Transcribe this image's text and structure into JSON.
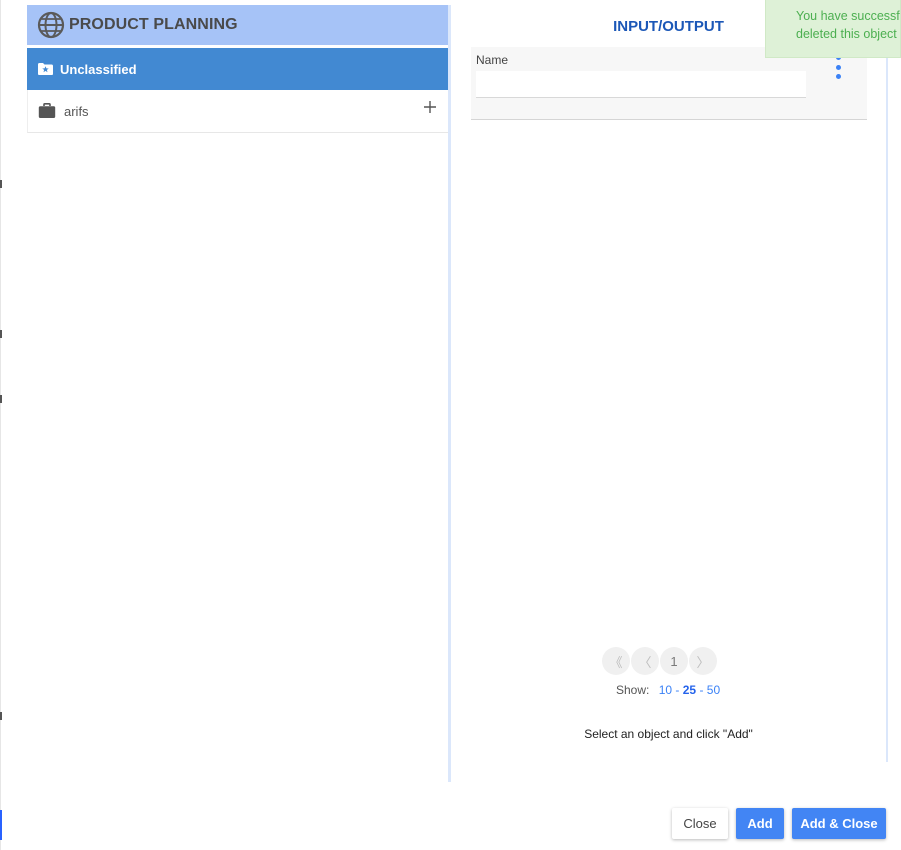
{
  "tree": {
    "header": {
      "title": "PRODUCT PLANNING",
      "icon": "globe-icon"
    },
    "items": [
      {
        "label": "Unclassified",
        "icon": "star-folder-icon",
        "selected": true
      },
      {
        "label": "arifs",
        "icon": "briefcase-icon",
        "action_icon": "plus-icon"
      }
    ]
  },
  "panel": {
    "title": "INPUT/OUTPUT",
    "filter": {
      "label": "Name",
      "value": "",
      "placeholder": ""
    }
  },
  "pagination": {
    "first": "《",
    "prev": "〈",
    "page": "1",
    "next": "〉",
    "show_label": "Show:",
    "sizes": [
      "10",
      "25",
      "50"
    ],
    "size_separator": "-",
    "active_size": "25"
  },
  "hint": "Select an object and click \"Add\"",
  "toast": {
    "line1": "You have successfully",
    "line2": "deleted this object"
  },
  "buttons": {
    "close": "Close",
    "add": "Add",
    "add_close": "Add & Close"
  },
  "colors": {
    "header_bg": "#a6c3f7",
    "selected_bg": "#4289d2",
    "title": "#1b57b7",
    "primary": "#4285f4",
    "toast_bg": "#def1d7",
    "toast_text": "#4caf50"
  }
}
